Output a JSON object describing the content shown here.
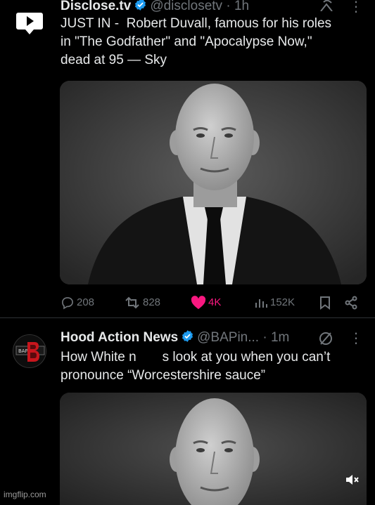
{
  "tweets": [
    {
      "name": "Disclose.tv",
      "handle": "@disclosetv",
      "separator": "·",
      "time": "1h",
      "more": "⋮",
      "text": "JUST IN -  Robert Duvall, famous for his roles\nin \"The Godfather\" and \"Apocalypse Now,\"\ndead at 95 — Sky",
      "avatar_icon": "play-badge-icon",
      "media": "black-and-white portrait photo",
      "actions": {
        "replies": "208",
        "reposts": "828",
        "likes": "4K",
        "views": "152K"
      }
    },
    {
      "name": "Hood Action News",
      "handle": "@BAPin...",
      "separator": "·",
      "time": "1m",
      "more": "⋮",
      "text": "How White n       s look at you when you can’t\npronounce “Worcestershire sauce”",
      "avatar_icon": "hood-action-news-logo",
      "avatar_text": "BAP",
      "media": "black-and-white portrait photo"
    }
  ],
  "watermark": "imgflip.com",
  "colors": {
    "background": "#000000",
    "text": "#e7e9ea",
    "muted": "#71767b",
    "verified": "#1d9bf0",
    "like": "#f91880",
    "divider": "#2f3336"
  }
}
